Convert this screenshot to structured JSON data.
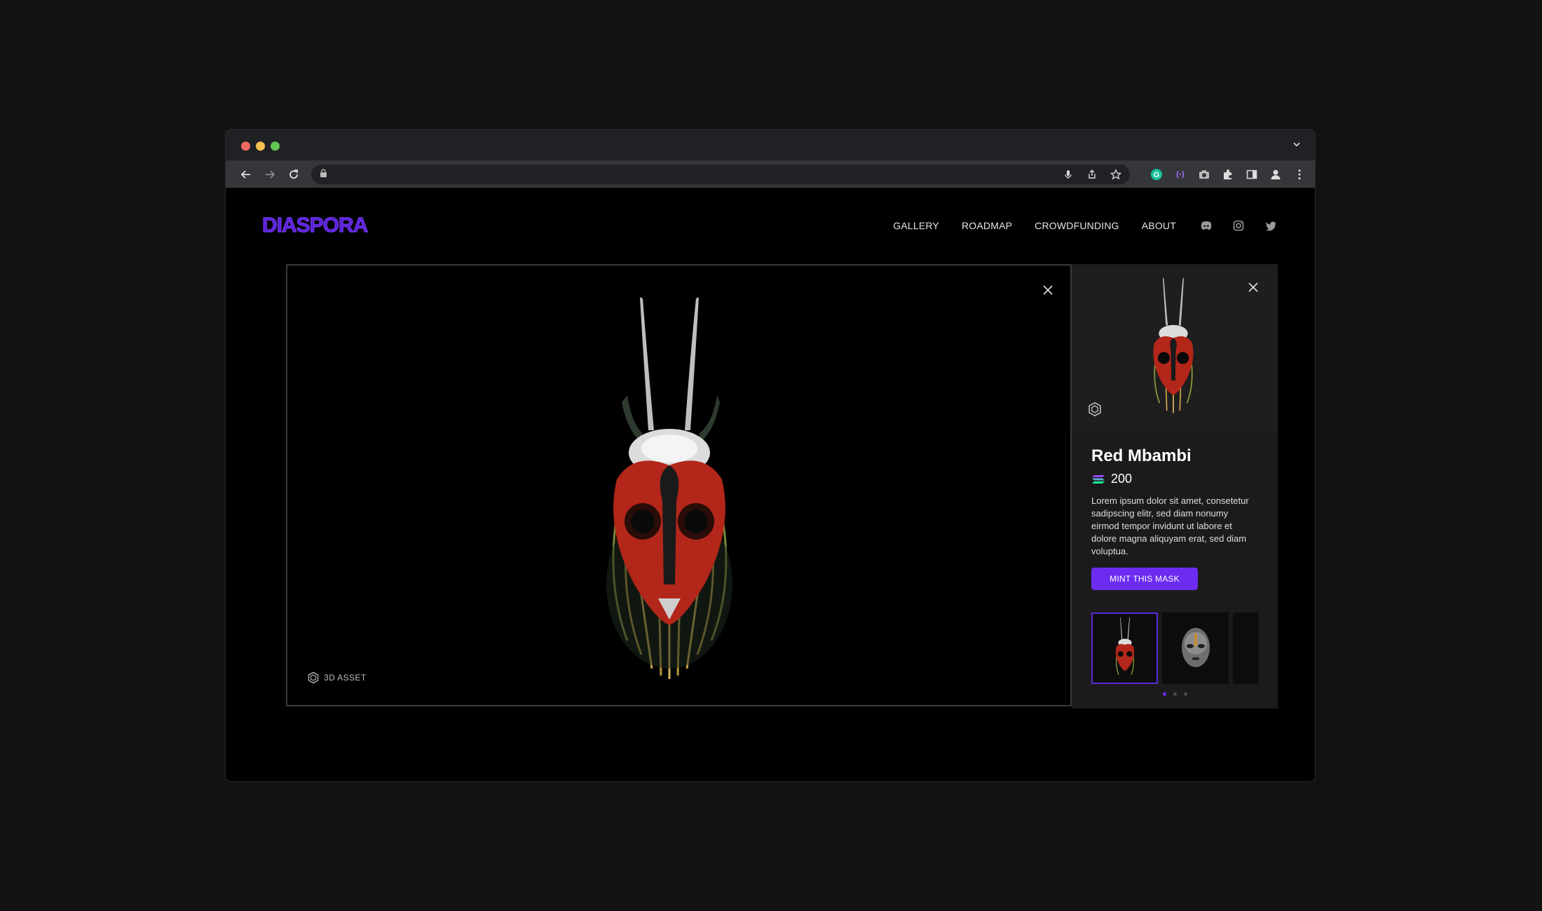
{
  "browser": {
    "url": "",
    "tab_menu_icon": "chevron-down-icon"
  },
  "site": {
    "logo": "DIASPORA",
    "nav": [
      {
        "label": "GALLERY"
      },
      {
        "label": "ROADMAP"
      },
      {
        "label": "CROWDFUNDING"
      },
      {
        "label": "ABOUT"
      }
    ],
    "social_icons": [
      "discord-icon",
      "instagram-icon",
      "twitter-icon"
    ]
  },
  "viewer": {
    "asset_label": "3D ASSET"
  },
  "panel": {
    "title": "Red Mbambi",
    "price": "200",
    "description": "Lorem ipsum dolor sit amet, consetetur sadipscing elitr, sed diam nonumy eirmod tempor invidunt ut labore et dolore magna aliquyam erat, sed diam voluptua.",
    "mint_label": "MINT THIS MASK",
    "active_thumb": 0,
    "active_dot": 0
  },
  "colors": {
    "accent": "#6b2bf0",
    "logo": "#5a21d6",
    "mask_red": "#b3261a"
  }
}
